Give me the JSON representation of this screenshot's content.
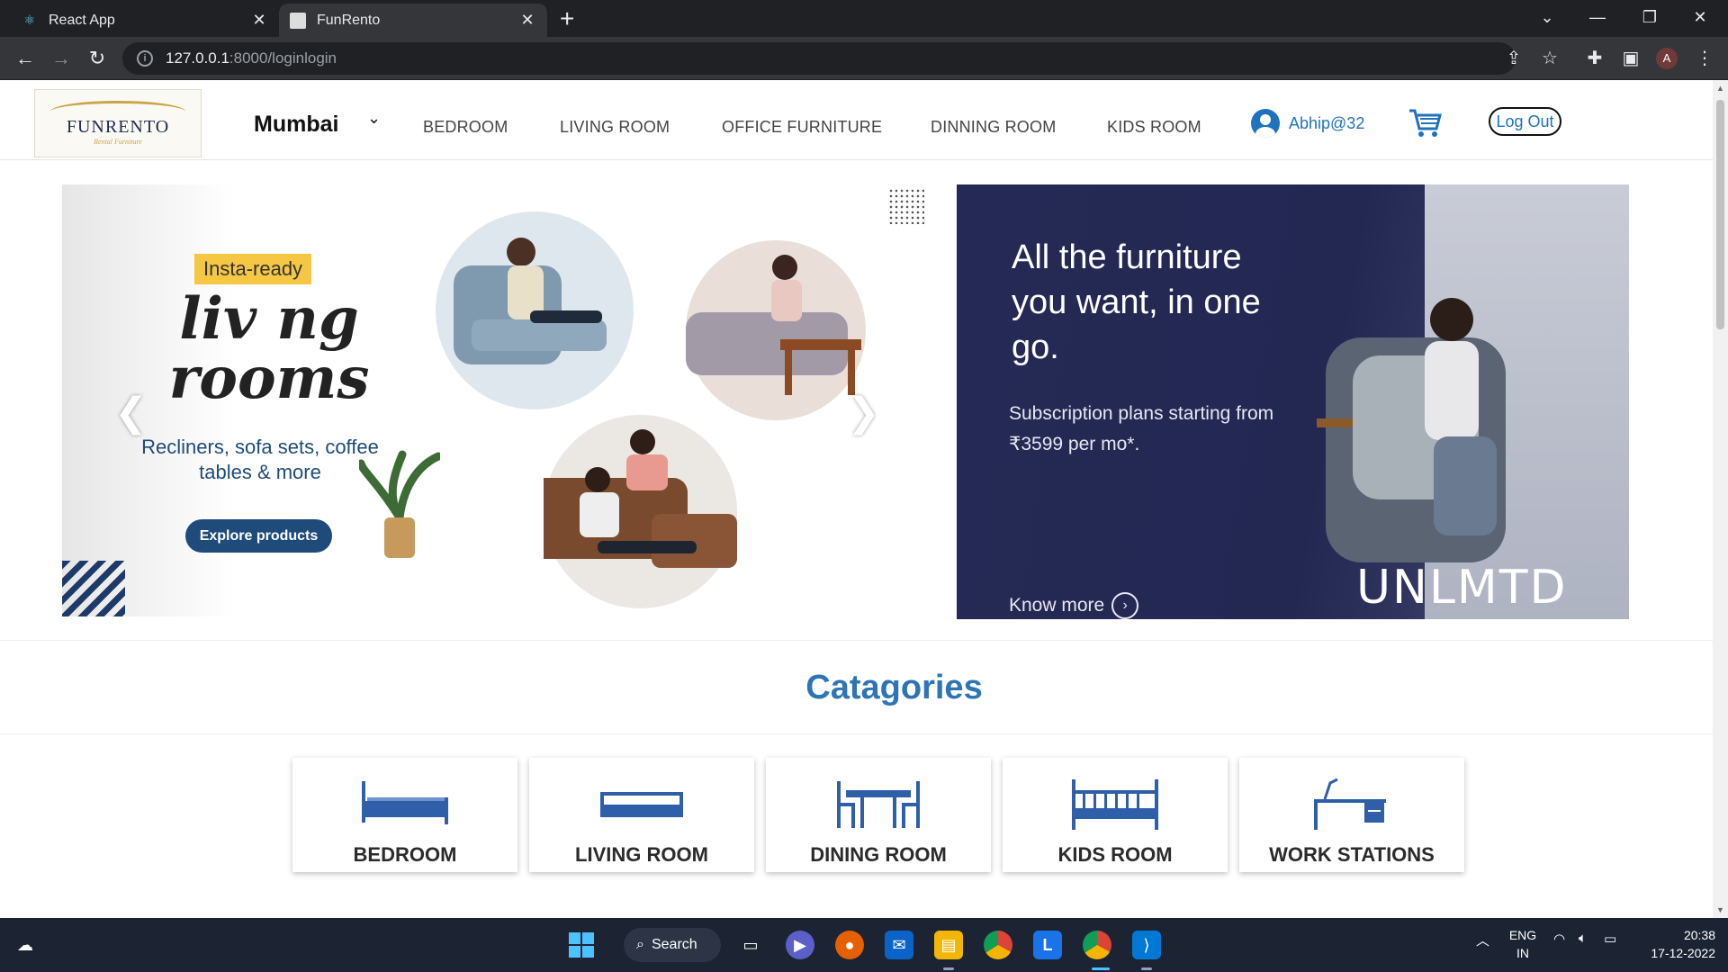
{
  "browser": {
    "tabs": [
      {
        "title": "React App",
        "active": false
      },
      {
        "title": "FunRento",
        "active": true
      }
    ],
    "url_host": "127.0.0.1",
    "url_path": ":8000/loginlogin"
  },
  "header": {
    "logo_text": "FUNRENTO",
    "logo_tagline": "Rental Furniture",
    "city": "Mumbai",
    "nav": [
      "BEDROOM",
      "LIVING ROOM",
      "OFFICE FURNITURE",
      "DINNING ROOM",
      "KIDS ROOM"
    ],
    "username": "Abhip@32",
    "logout_label": "Log Out"
  },
  "banner_left": {
    "badge": "Insta-ready",
    "headline_1": "liv  ng",
    "headline_2": "rooms",
    "subtext": "Recliners, sofa sets, coffee tables & more",
    "cta": "Explore products"
  },
  "banner_right": {
    "headline": "All the furniture you want, in one go.",
    "subtext": "Subscription plans starting from ₹3599 per mo*.",
    "cta": "Know more",
    "brand": "UNLMTD"
  },
  "categories": {
    "title": "Catagories",
    "items": [
      "BEDROOM",
      "LIVING ROOM",
      "DINING ROOM",
      "KIDS ROOM",
      "WORK STATIONS"
    ]
  },
  "taskbar": {
    "search_label": "Search",
    "lang_1": "ENG",
    "lang_2": "IN",
    "time": "20:38",
    "date": "17-12-2022"
  },
  "colors": {
    "accent": "#2e75b6",
    "banner_navy": "#242a55",
    "badge_yellow": "#f6c744"
  }
}
